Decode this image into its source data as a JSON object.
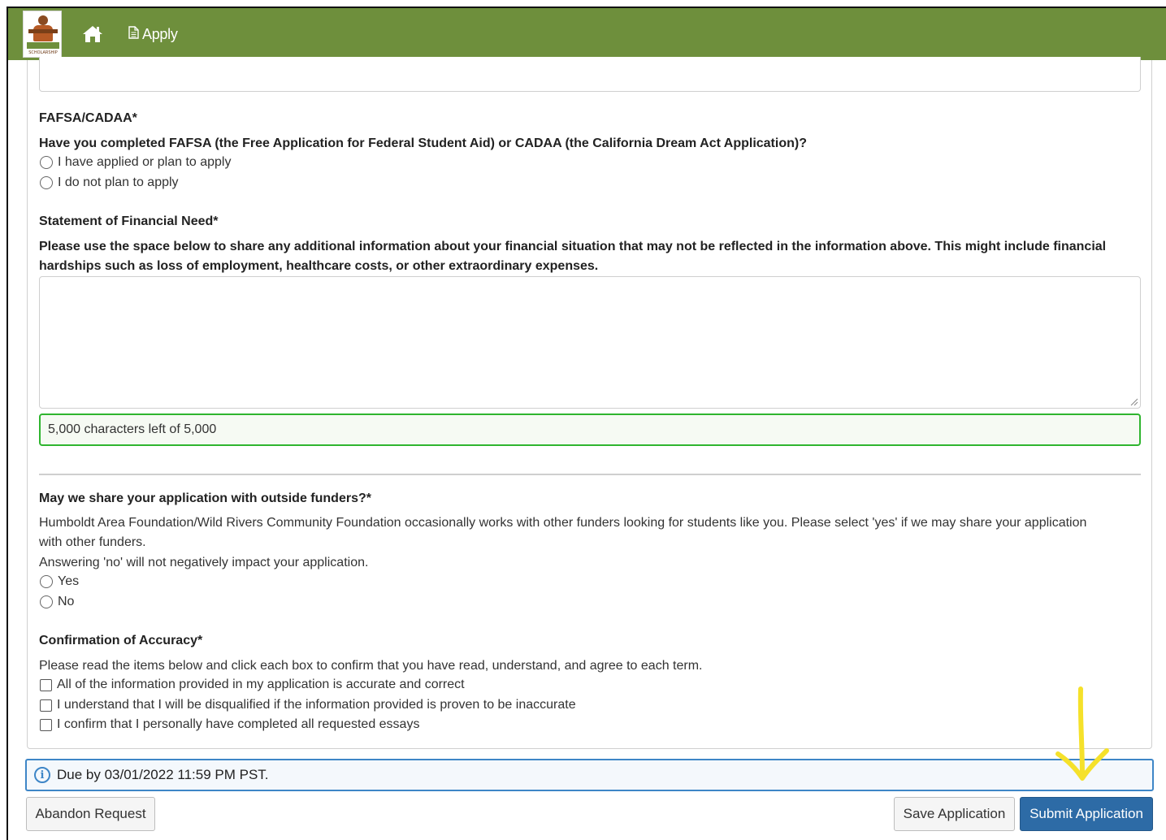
{
  "nav": {
    "logo_text": "SCHOLARSHIP FINDER",
    "apply_label": "Apply"
  },
  "fafsa": {
    "heading": "FAFSA/CADAA*",
    "question": "Have you completed FAFSA (the Free Application for Federal Student Aid) or CADAA (the California Dream Act Application)?",
    "options": [
      "I have applied or plan to apply",
      "I do not plan to apply"
    ]
  },
  "financial_need": {
    "heading": "Statement of Financial Need*",
    "question": "Please use the space below to share any additional information about your financial situation that may not be reflected in the information above. This might include financial hardships such as loss of employment, healthcare costs, or other extraordinary expenses.",
    "value": "",
    "char_count": "5,000 characters left of 5,000"
  },
  "share": {
    "heading": "May we share your application with outside funders?*",
    "description": "Humboldt Area Foundation/Wild Rivers Community Foundation occasionally works with other funders looking for students like you. Please select 'yes' if we may share your application with other funders.",
    "note": "Answering 'no' will not negatively impact your application.",
    "options": [
      "Yes",
      "No"
    ]
  },
  "confirmation": {
    "heading": "Confirmation of Accuracy*",
    "instructions": "Please read the items below and click each box to confirm that you have read, understand, and agree to each term.",
    "items": [
      "All of the information provided in my application is accurate and correct",
      "I understand that I will be disqualified if the information provided is proven to be inaccurate",
      "I confirm that I personally have completed all requested essays"
    ]
  },
  "due": {
    "text": "Due by 03/01/2022 11:59 PM PST."
  },
  "footer": {
    "abandon_label": "Abandon Request",
    "save_label": "Save Application",
    "submit_label": "Submit Application"
  },
  "colors": {
    "navbar": "#6e8f3c",
    "primary": "#2d6ba6",
    "charcount_border": "#2fb52f",
    "due_border": "#3e86c7",
    "annotation_arrow": "#f5e12a"
  }
}
